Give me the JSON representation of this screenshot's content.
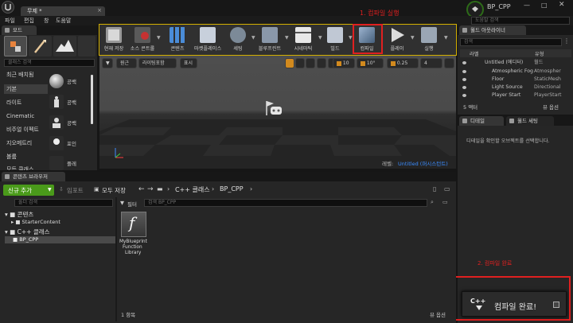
{
  "title_bar": {
    "tab_title": "무제 *",
    "top_right_search_placeholder": "도움말 검색"
  },
  "menu": [
    "파일",
    "편집",
    "창",
    "도움말"
  ],
  "modes": {
    "tab_label": "모드",
    "search_placeholder": "클래스 검색",
    "categories": [
      "최근 배치됨",
      "기본",
      "라이트",
      "Cinematic",
      "비주얼 이펙트",
      "지오메트리",
      "볼륨",
      "모든 클래스"
    ],
    "selected_category": "기본",
    "items": [
      "공백",
      "공백",
      "공백",
      "포인",
      "플레"
    ]
  },
  "toolbar": {
    "buttons": [
      "현재 저장",
      "소스 콘트롤",
      "콘텐츠",
      "마켓플레이스",
      "세팅",
      "블루프린트",
      "시네마틱",
      "빌드",
      "컴파일",
      "플레이",
      "실행"
    ]
  },
  "annotations": {
    "step1": "1. 컴파일 실행",
    "step2": "2. 컴파일 완료"
  },
  "viewport": {
    "perspective_label": "원근",
    "lit_label": "라이팅포함",
    "show_label": "표시",
    "grid_value": "10",
    "rotation_value": "10°",
    "scale_value": "0.25",
    "camera_speed": "4",
    "level_label": "레벨:",
    "level_name": "Untitled (퍼시스턴트)"
  },
  "world_outliner": {
    "tab_label": "월드 아웃라이너",
    "search_placeholder": "검색",
    "col_label": "라벨",
    "col_type": "유형",
    "rows": [
      {
        "label": "Untitled (에디터)",
        "type": "월드"
      },
      {
        "label": "Atmospheric Fog",
        "type": "Atmospher"
      },
      {
        "label": "Floor",
        "type": "StaticMesh"
      },
      {
        "label": "Light Source",
        "type": "Directional"
      },
      {
        "label": "Player Start",
        "type": "PlayerStart"
      }
    ],
    "actor_count": "5 액터",
    "view_options": "뷰 옵션"
  },
  "details": {
    "tab_details": "디테일",
    "tab_world_settings": "월드 세팅",
    "hint": "디테일을 확인할 오브젝트를 선택합니다."
  },
  "content_browser": {
    "tab_label": "콘텐츠 브라우저",
    "add_new": "신규 추가",
    "import": "임포트",
    "save_all": "모두 저장",
    "breadcrumb": [
      "C++ 클래스",
      "BP_CPP"
    ],
    "filter_label": "필터",
    "filter_search_placeholder": "검색 BP_CPP",
    "folder_search_placeholder": "폴더 검색",
    "tree": [
      {
        "label": "콘텐츠",
        "depth": 0
      },
      {
        "label": "StarterContent",
        "depth": 1
      },
      {
        "label": "C++ 클래스",
        "depth": 0
      },
      {
        "label": "BP_CPP",
        "depth": 1
      }
    ],
    "asset_icon_letter": "f",
    "asset_name_lines": [
      "MyBlueprint",
      "Function",
      "Library"
    ],
    "item_count": "1 항목",
    "view_options": "뷰 옵션"
  },
  "notification": {
    "cpp_badge": "C++",
    "message": "컴파일 완료!"
  },
  "colors": {
    "accent_green": "#4a9a1a",
    "annotation_red": "#e02020",
    "level_name_blue": "#3a8cff"
  }
}
